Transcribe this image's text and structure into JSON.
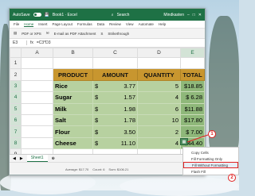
{
  "window": {
    "autosave_label": "AutoSave",
    "file_name": "Book1 · Excel",
    "search_placeholder": "Search",
    "user_name": "Mindkasten"
  },
  "menubar": [
    "File",
    "Home",
    "Insert",
    "Page Layout",
    "Formulas",
    "Data",
    "Review",
    "View",
    "Automate",
    "Help"
  ],
  "menubar_active": "Home",
  "ribbon": [
    "PDF or XPS",
    "E-mail as PDF Attachment",
    "Strikethrough"
  ],
  "formula": {
    "cell": "E3",
    "fx": "fx",
    "value": "=C3*D3"
  },
  "columns": [
    "A",
    "B",
    "C",
    "D",
    "E"
  ],
  "rows": [
    "1",
    "2",
    "3",
    "4",
    "5",
    "6",
    "7",
    "8",
    "9"
  ],
  "table_headers": [
    "PRODUCT",
    "AMOUNT",
    "QUANTITY",
    "TOTAL"
  ],
  "table_rows": [
    {
      "product": "Rice",
      "currency": "$",
      "amount": "3.77",
      "qty": "5",
      "total": "$18.85"
    },
    {
      "product": "Sugar",
      "currency": "$",
      "amount": "1.57",
      "qty": "4",
      "total": "$ 6.28"
    },
    {
      "product": "Milk",
      "currency": "$",
      "amount": "1.98",
      "qty": "6",
      "total": "$11.88"
    },
    {
      "product": "Salt",
      "currency": "$",
      "amount": "1.78",
      "qty": "10",
      "total": "$17.80"
    },
    {
      "product": "Flour",
      "currency": "$",
      "amount": "3.50",
      "qty": "2",
      "total": "$ 7.00"
    },
    {
      "product": "Cheese",
      "currency": "$",
      "amount": "11.10",
      "qty": "4",
      "total": "$44.40"
    }
  ],
  "sheet_tab": "Sheet1",
  "status": {
    "average": "Average: $17.70",
    "count": "Count: 6",
    "sum": "Sum: $106.21"
  },
  "fill_menu": [
    "Copy Cells",
    "Fill Formatting Only",
    "Fill Without Formatting",
    "Flash Fill"
  ],
  "callouts": [
    "1",
    "2"
  ],
  "colors": {
    "excel_green": "#1e7145",
    "header_fill": "#c8962f",
    "row_fill": "#b7d1a0",
    "callout": "#e02020"
  }
}
